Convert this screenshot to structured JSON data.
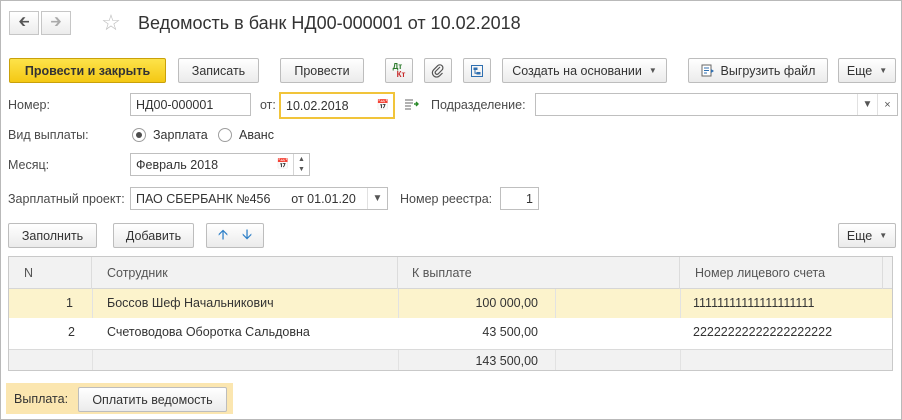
{
  "window": {
    "title": "Ведомость в банк НД00-000001 от 10.02.2018"
  },
  "toolbar": {
    "post_close": "Провести и закрыть",
    "save": "Записать",
    "post": "Провести",
    "dtkt_top": "Дт",
    "dtkt_bottom": "Кт",
    "create_based": "Создать на основании",
    "export_file": "Выгрузить файл",
    "more": "Еще"
  },
  "form": {
    "number_label": "Номер:",
    "number_value": "НД00-000001",
    "date_label": "от:",
    "date_value": "10.02.2018",
    "department_label": "Подразделение:",
    "department_value": "",
    "payment_type_label": "Вид выплаты:",
    "payment_option_salary": "Зарплата",
    "payment_option_advance": "Аванс",
    "month_label": "Месяц:",
    "month_value": "Февраль 2018",
    "project_label": "Зарплатный проект:",
    "project_value": "ПАО СБЕРБАНК №456      от 01.01.20",
    "registry_label": "Номер реестра:",
    "registry_value": "1"
  },
  "table_toolbar": {
    "fill": "Заполнить",
    "add": "Добавить",
    "more": "Еще"
  },
  "table": {
    "headers": [
      "N",
      "Сотрудник",
      "К выплате",
      "Номер лицевого счета"
    ],
    "rows": [
      {
        "n": "1",
        "employee": "Боссов Шеф Начальникович",
        "amount": "100 000,00",
        "account": "11111111111111111111"
      },
      {
        "n": "2",
        "employee": "Счетоводова Оборотка Сальдовна",
        "amount": "43 500,00",
        "account": "22222222222222222222"
      }
    ],
    "total": "143 500,00"
  },
  "payment": {
    "label": "Выплата:",
    "button": "Оплатить ведомость"
  },
  "colors": {
    "primary_button": "#f4c814",
    "selected_row": "#fcf3cc",
    "payment_group": "#fbe6b0",
    "focus_border": "#f1c43a"
  }
}
